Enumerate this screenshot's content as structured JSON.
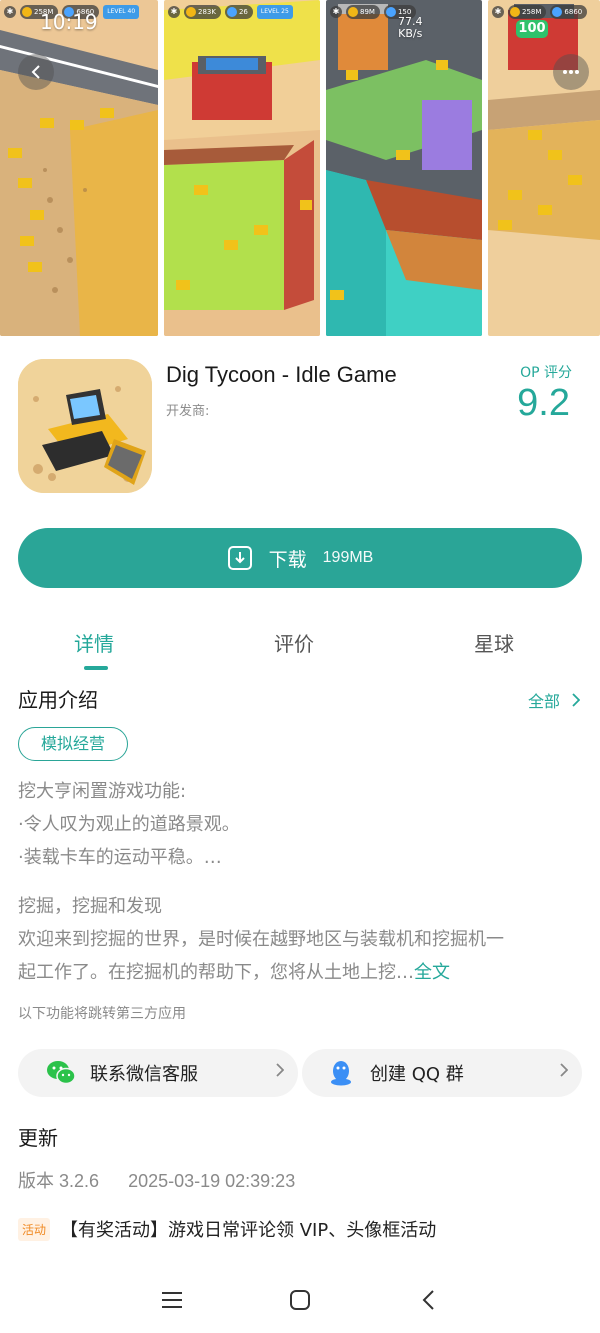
{
  "status": {
    "time": "10:19",
    "speed_value": "77.4",
    "speed_unit": "KB/s",
    "battery": "100"
  },
  "screenshots": [
    {
      "coins": "258M",
      "gems": "6860",
      "level": "LEVEL 40"
    },
    {
      "coins": "283K",
      "gems": "26",
      "level": "LEVEL 25"
    },
    {
      "coins": "89M",
      "gems": "150"
    },
    {
      "coins": "258M",
      "gems": "6860"
    }
  ],
  "app": {
    "name": "Dig Tycoon - Idle Game",
    "developer": "开发商:",
    "score_label": "OP 评分",
    "score": "9.2"
  },
  "download": {
    "label": "下载",
    "size": "199MB"
  },
  "tabs": [
    {
      "label": "详情"
    },
    {
      "label": "评价"
    },
    {
      "label": "星球"
    }
  ],
  "intro": {
    "title": "应用介绍",
    "view_all": "全部",
    "tag": "模拟经营",
    "lines1": [
      "挖大亨闲置游戏功能:",
      "·令人叹为观止的道路景观。",
      "·装载卡车的运动平稳。…"
    ],
    "lines2": [
      "挖掘，挖掘和发现",
      "欢迎来到挖掘的世界，是时候在越野地区与装载机和挖掘机一",
      "起工作了。在挖掘机的帮助下，您将从土地上挖…"
    ],
    "more": "全文",
    "note": "以下功能将跳转第三方应用"
  },
  "links": {
    "wechat": "联系微信客服",
    "qq": "创建 QQ 群"
  },
  "update": {
    "title": "更新",
    "version": "版本 3.2.6",
    "date": "2025-03-19 02:39:23"
  },
  "activity": {
    "badge": "活动",
    "text": "【有奖活动】游戏日常评论领 VIP、头像框活动"
  },
  "colors": {
    "accent": "#2aa597",
    "text": "#222222",
    "muted": "#8a8a8a"
  }
}
